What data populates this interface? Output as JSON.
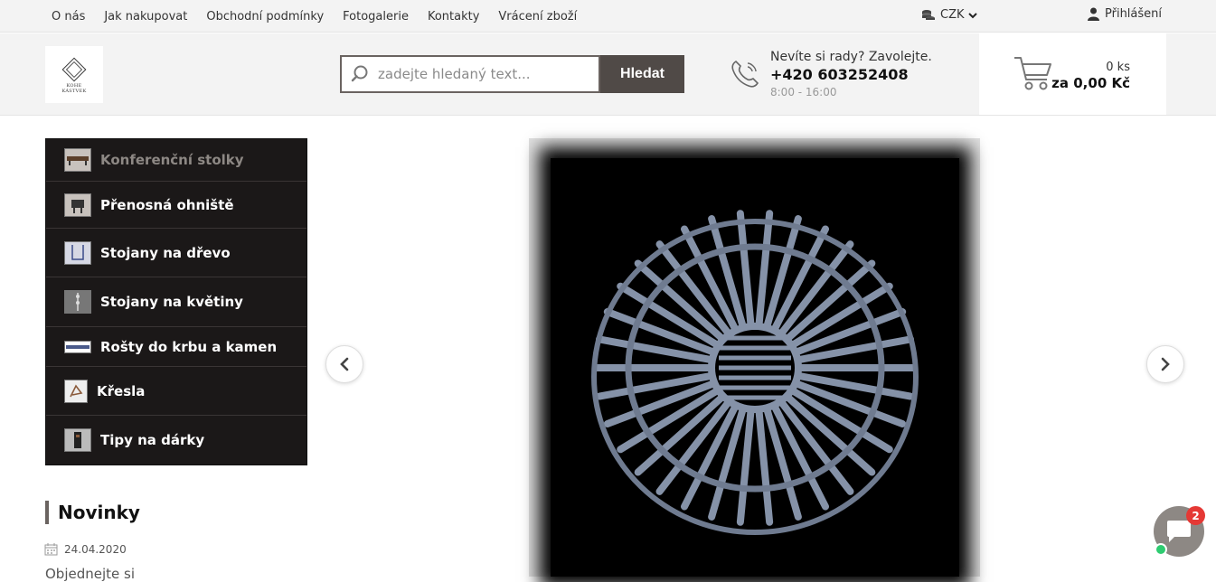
{
  "topnav": {
    "links": [
      "O nás",
      "Jak nakupovat",
      "Obchodní podmínky",
      "Fotogalerie",
      "Kontakty",
      "Vrácení zboží"
    ],
    "currency": "CZK",
    "login": "Přihlášení"
  },
  "header": {
    "logo_line1": "KOHE",
    "logo_line2": "KÁSTVEK",
    "search_placeholder": "zadejte hledaný text...",
    "search_button": "Hledat",
    "contact_question": "Nevíte si rady? Zavolejte.",
    "contact_phone": "+420 603252408",
    "contact_hours": "8:00 - 16:00",
    "cart_qty": "0 ks",
    "cart_sum": "za 0,00 Kč"
  },
  "categories": [
    {
      "label": "Konferenční stolky",
      "active": true
    },
    {
      "label": "Přenosná ohniště",
      "active": false
    },
    {
      "label": "Stojany na dřevo",
      "active": false
    },
    {
      "label": "Stojany na květiny",
      "active": false
    },
    {
      "label": "Rošty do krbu a kamen",
      "active": false
    },
    {
      "label": "Křesla",
      "active": false
    },
    {
      "label": "Tipy na dárky",
      "active": false
    }
  ],
  "news": {
    "title": "Novinky",
    "date": "24.04.2020",
    "link": "Objednejte si"
  },
  "chat": {
    "badge": "2"
  },
  "colors": {
    "accent": "#504a47",
    "sidebar_bg": "#1b1818",
    "chat_bg": "#8d8884",
    "badge": "#e53935"
  }
}
